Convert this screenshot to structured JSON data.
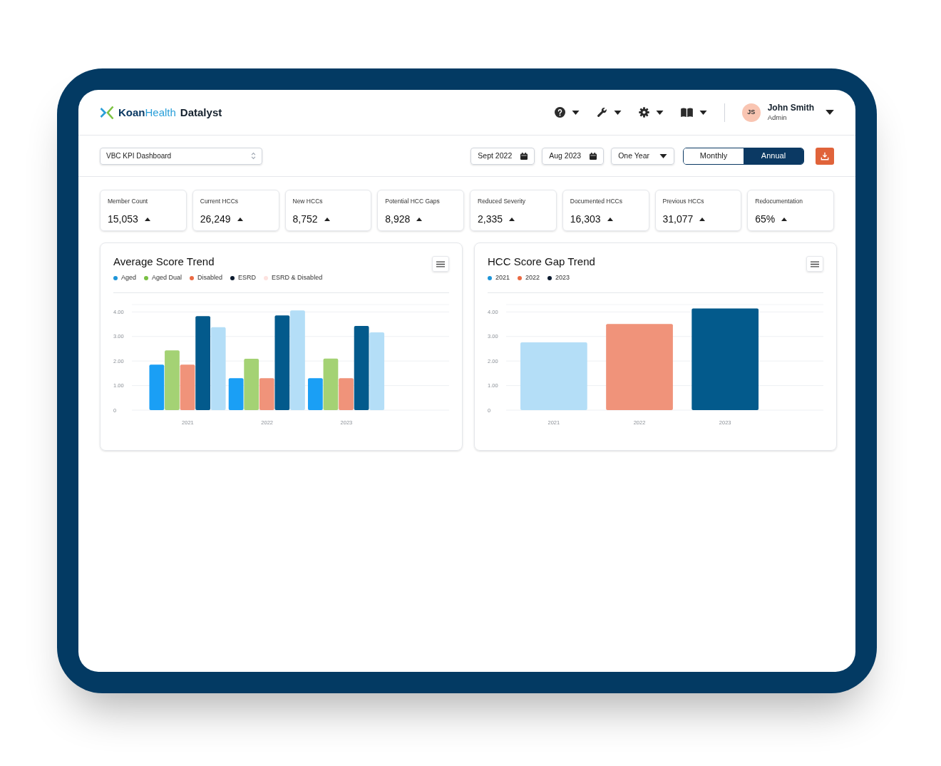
{
  "header": {
    "logo": {
      "name_parts": [
        "Koan",
        "Health"
      ],
      "product": "Datalyst"
    },
    "user": {
      "initials": "JS",
      "name": "John Smith",
      "role": "Admin"
    }
  },
  "filters": {
    "dashboard": {
      "value": "VBC KPI Dashboard"
    },
    "start_date": {
      "value": "Sept 2022"
    },
    "end_date": {
      "value": "Aug 2023"
    },
    "range": {
      "value": "One Year"
    },
    "period": [
      {
        "label": "Monthly",
        "selected": false
      },
      {
        "label": "Annual",
        "selected": true
      }
    ]
  },
  "kpis": [
    {
      "label": "Member Count",
      "value": "15,053"
    },
    {
      "label": "Current HCCs",
      "value": "26,249"
    },
    {
      "label": "New HCCs",
      "value": "8,752"
    },
    {
      "label": "Potential HCC Gaps",
      "value": "8,928"
    },
    {
      "label": "Reduced Severity",
      "value": "2,335"
    },
    {
      "label": "Documented HCCs",
      "value": "16,303"
    },
    {
      "label": "Previous HCCs",
      "value": "31,077"
    },
    {
      "label": "Redocumentation",
      "value": "65%"
    }
  ],
  "charts": [
    {
      "legend": [
        {
          "color": "#1e95d8"
        },
        {
          "color": "#79c043"
        },
        {
          "color": "#ea6a43"
        },
        {
          "color": "#0b1a2e"
        },
        {
          "color": "#fde2df"
        }
      ],
      "chart_data": {
        "type": "bar",
        "title": "Average Score Trend",
        "categories": [
          "2021",
          "2022",
          "2023"
        ],
        "series": [
          {
            "name": "Aged",
            "color": "#1a9ff5",
            "values": [
              1.85,
              1.3,
              1.3
            ]
          },
          {
            "name": "Aged Dual",
            "color": "#a4d274",
            "values": [
              2.43,
              2.09,
              2.1
            ]
          },
          {
            "name": "Disabled",
            "color": "#f0937a",
            "values": [
              1.85,
              1.3,
              1.3
            ]
          },
          {
            "name": "ESRD",
            "color": "#035a8c",
            "values": [
              3.83,
              3.86,
              3.43
            ]
          },
          {
            "name": "ESRD & Disabled",
            "color": "#b4def7",
            "values": [
              3.38,
              4.06,
              3.17
            ]
          }
        ],
        "grid": true,
        "ylim": [
          0,
          4.3
        ],
        "yticks": [
          {
            "value": 0,
            "label": "0"
          },
          {
            "value": 1,
            "label": "1.00"
          },
          {
            "value": 2,
            "label": "2.00"
          },
          {
            "value": 3,
            "label": "3.00"
          },
          {
            "value": 4,
            "label": "4.00"
          }
        ]
      }
    },
    {
      "legend": [
        {
          "label": "2021",
          "color": "#1e95d8"
        },
        {
          "label": "2022",
          "color": "#ea6a43"
        },
        {
          "label": "2023",
          "color": "#0b1a2e"
        }
      ],
      "chart_data": {
        "type": "bar",
        "title": "HCC Score Gap Trend",
        "categories": [
          "2021",
          "2022",
          "2023"
        ],
        "series": [
          {
            "values": [
              2.76,
              3.51,
              4.14
            ],
            "colors": [
              "#b4def7",
              "#f0937a",
              "#035a8c"
            ]
          }
        ],
        "grid": true,
        "ylim": [
          0,
          4.3
        ],
        "yticks": [
          {
            "value": 0,
            "label": "0"
          },
          {
            "value": 1,
            "label": "1.00"
          },
          {
            "value": 2,
            "label": "2.00"
          },
          {
            "value": 3,
            "label": "3.00"
          },
          {
            "value": 4,
            "label": "4.00"
          }
        ]
      }
    }
  ]
}
